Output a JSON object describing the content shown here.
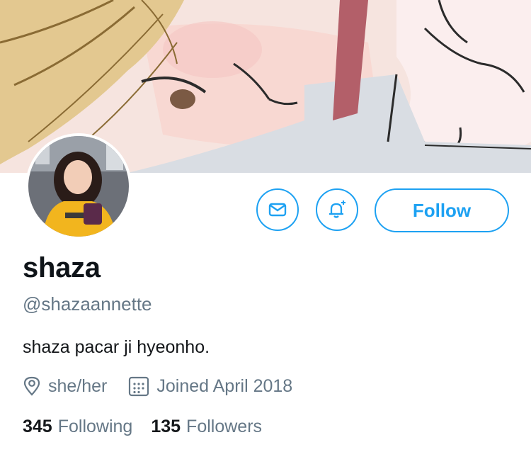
{
  "profile": {
    "display_name": "shaza",
    "handle": "@shazaannette",
    "bio": "shaza pacar ji hyeonho.",
    "location": "she/her",
    "joined": "Joined April 2018"
  },
  "actions": {
    "message_icon": "envelope-icon",
    "notify_icon": "bell-plus-icon",
    "follow_label": "Follow"
  },
  "stats": {
    "following_count": "345",
    "following_label": "Following",
    "followers_count": "135",
    "followers_label": "Followers"
  },
  "colors": {
    "accent": "#1da1f2",
    "secondary_text": "#657786",
    "primary_text": "#14171a"
  }
}
